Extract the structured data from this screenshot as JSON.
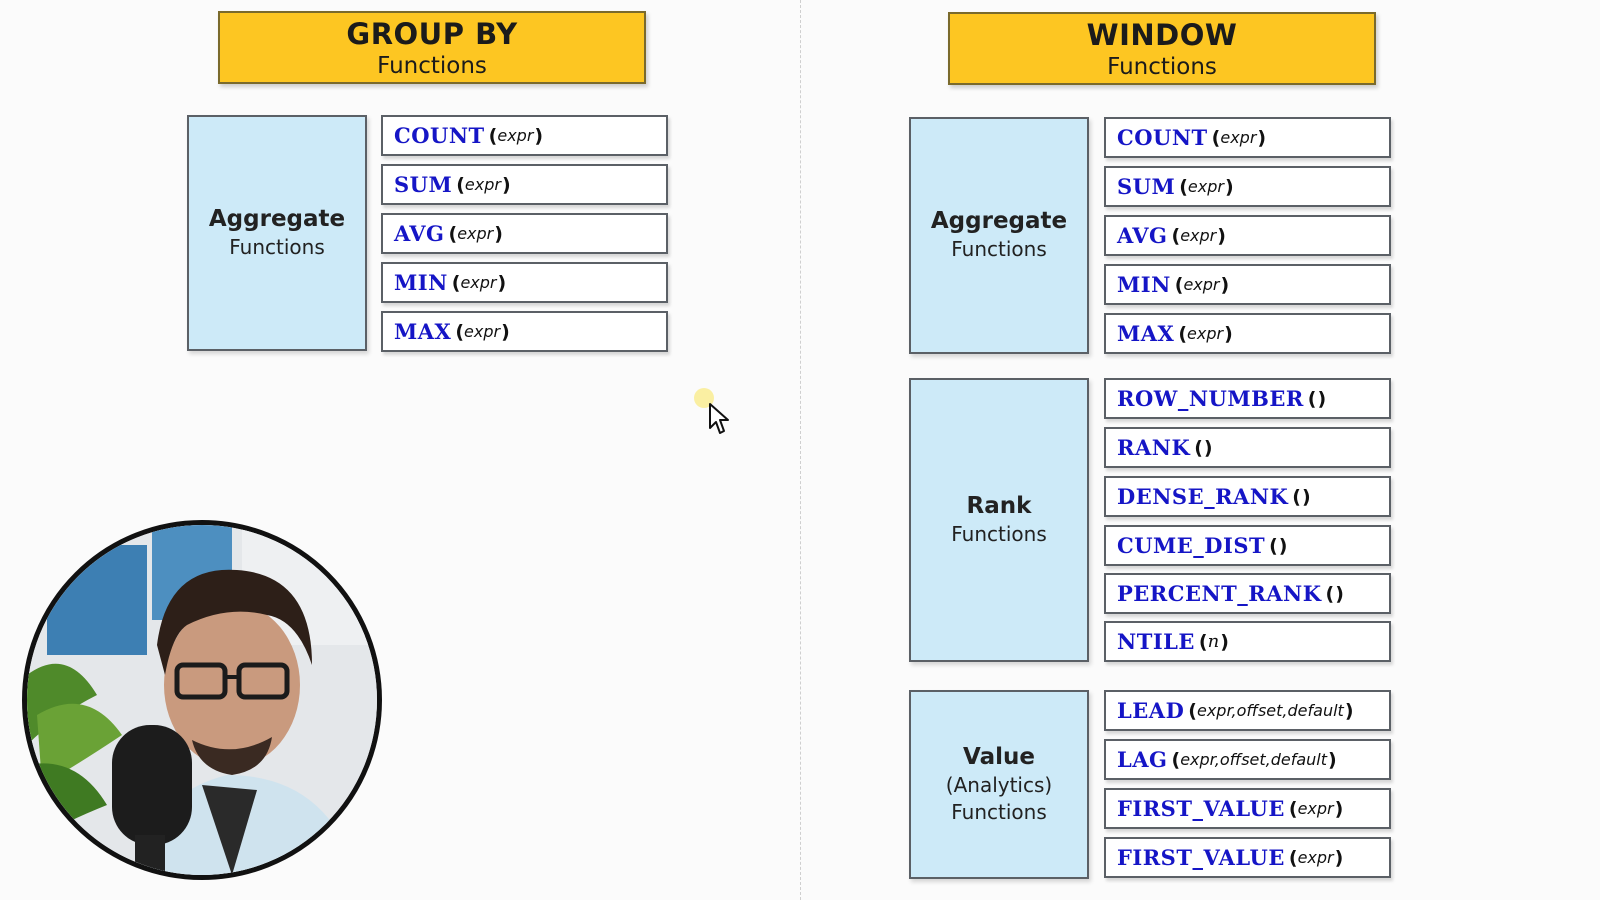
{
  "group_by": {
    "title": "GROUP BY",
    "subtitle": "Functions",
    "categories": [
      {
        "title": "Aggregate",
        "subtitle_lines": [
          "Functions"
        ],
        "functions": [
          {
            "name": "COUNT",
            "arg": "expr"
          },
          {
            "name": "SUM",
            "arg": "expr"
          },
          {
            "name": "AVG",
            "arg": "expr"
          },
          {
            "name": "MIN",
            "arg": "expr"
          },
          {
            "name": "MAX",
            "arg": "expr"
          }
        ]
      }
    ]
  },
  "window": {
    "title": "WINDOW",
    "subtitle": "Functions",
    "categories": [
      {
        "title": "Aggregate",
        "subtitle_lines": [
          "Functions"
        ],
        "functions": [
          {
            "name": "COUNT",
            "arg": "expr"
          },
          {
            "name": "SUM",
            "arg": "expr"
          },
          {
            "name": "AVG",
            "arg": "expr"
          },
          {
            "name": "MIN",
            "arg": "expr"
          },
          {
            "name": "MAX",
            "arg": "expr"
          }
        ]
      },
      {
        "title": "Rank",
        "subtitle_lines": [
          "Functions"
        ],
        "functions": [
          {
            "name": "ROW_NUMBER",
            "arg": ""
          },
          {
            "name": "RANK",
            "arg": ""
          },
          {
            "name": "DENSE_RANK",
            "arg": ""
          },
          {
            "name": "CUME_DIST",
            "arg": ""
          },
          {
            "name": "PERCENT_RANK",
            "arg": ""
          },
          {
            "name": "NTILE",
            "arg": "n"
          }
        ]
      },
      {
        "title": "Value",
        "subtitle_lines": [
          "(Analytics)",
          "Functions"
        ],
        "functions": [
          {
            "name": "LEAD",
            "arg": "expr,offset,default"
          },
          {
            "name": "LAG",
            "arg": "expr,offset,default"
          },
          {
            "name": "FIRST_VALUE",
            "arg": "expr"
          },
          {
            "name": "FIRST_VALUE",
            "arg": "expr"
          }
        ]
      }
    ]
  },
  "colors": {
    "header_fill": "#fdc622",
    "category_fill": "#cdeaf8",
    "function_name": "#1515c6"
  },
  "icons": [
    "mouse-pointer-icon"
  ]
}
